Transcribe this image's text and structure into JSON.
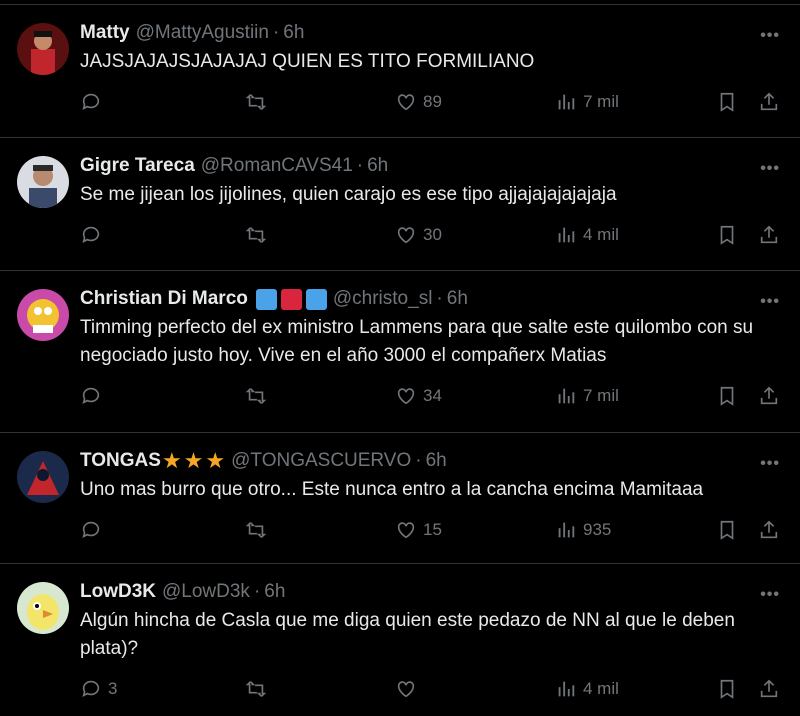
{
  "tweets": [
    {
      "name": "Matty",
      "handle": "@MattyAgustiin",
      "time": "6h",
      "text": "JAJSJAJAJSJAJAJAJ QUIEN ES TITO FORMILIANO",
      "replies": "",
      "likes": "89",
      "views": "7 mil",
      "avatar_color": "#8b1d1d"
    },
    {
      "name": "Gigre Tareca",
      "handle": "@RomanCAVS41",
      "time": "6h",
      "text": "Se me jijean los jijolines, quien carajo es ese tipo ajjajajajajajaja",
      "replies": "",
      "likes": "30",
      "views": "4 mil",
      "avatar_color": "#c9ced6"
    },
    {
      "name": "Christian Di Marco",
      "handle": "@christo_sl",
      "time": "6h",
      "text": "Timming perfecto del ex ministro Lammens para que salte este quilombo con su negociado justo hoy. Vive en el año 3000 el compañerx Matias",
      "replies": "",
      "likes": "34",
      "views": "7 mil",
      "avatar_color": "#f2c230",
      "flag_colors": [
        "#4aa3e8",
        "#d7263d",
        "#4aa3e8"
      ]
    },
    {
      "name": "TONGAS",
      "handle": "@TONGASCUERVO",
      "time": "6h",
      "text": "Uno mas burro que otro... Este nunca entro a la cancha encima Mamitaaa",
      "replies": "",
      "likes": "15",
      "views": "935",
      "avatar_color": "#1b2a4a",
      "stars": [
        "★",
        "★",
        "★"
      ]
    },
    {
      "name": "LowD3K",
      "handle": "@LowD3k",
      "time": "6h",
      "text": "Algún hincha de Casla que me diga quien este pedazo de NN al que le deben plata)?",
      "replies": "3",
      "likes": "",
      "views": "4 mil",
      "avatar_color": "#f2e56a"
    }
  ],
  "ui": {
    "more_label": "•••",
    "dot": "·"
  },
  "icons": [
    "reply-icon",
    "retweet-icon",
    "like-icon",
    "views-icon",
    "bookmark-icon",
    "share-icon",
    "more-icon"
  ]
}
